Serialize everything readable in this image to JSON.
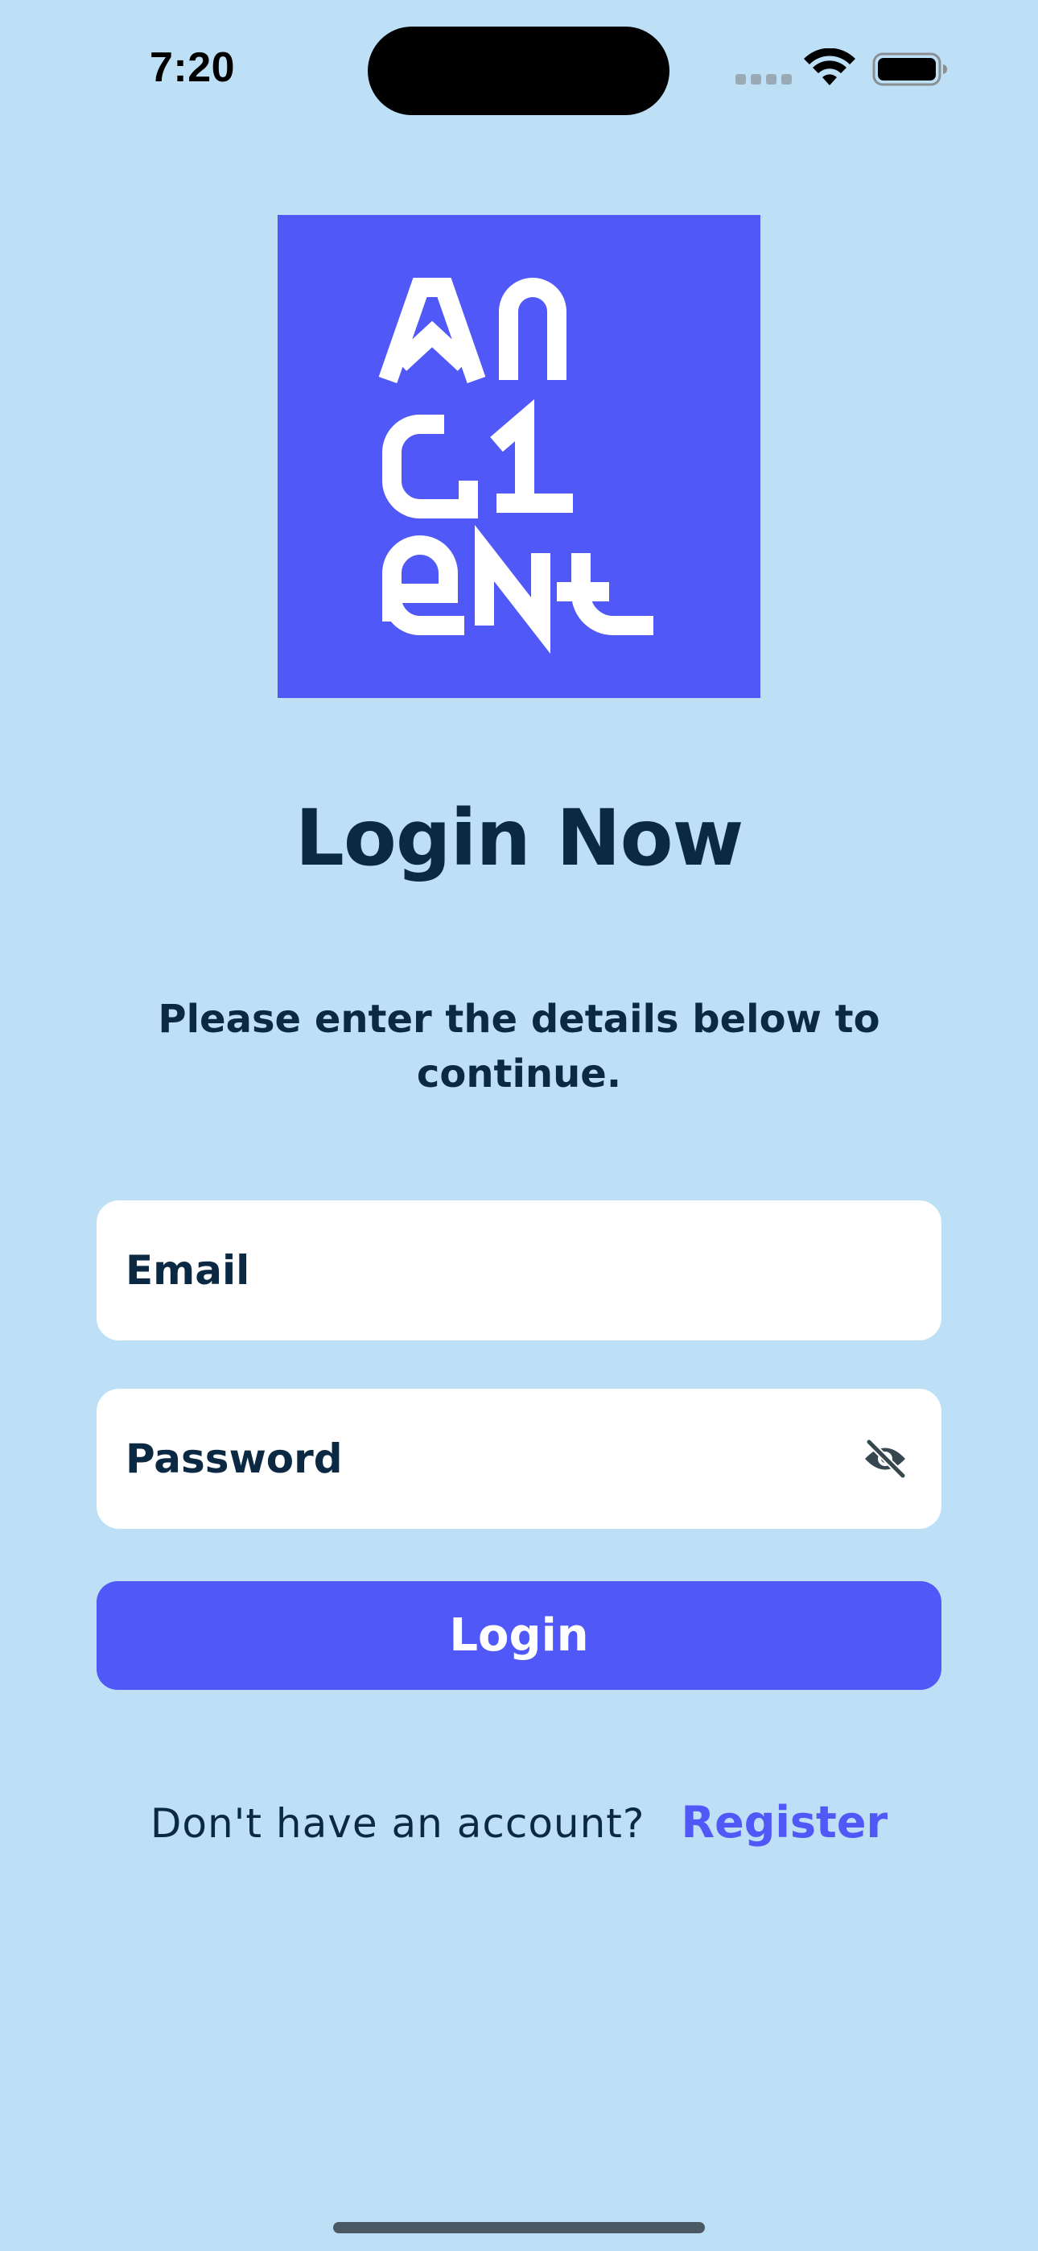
{
  "status_bar": {
    "time": "7:20"
  },
  "logo": {
    "brand_text": "ANCIENT",
    "background_color": "#5058f8"
  },
  "login": {
    "title": "Login Now",
    "subtitle": "Please enter the details below to continue.",
    "email": {
      "placeholder": "Email",
      "value": ""
    },
    "password": {
      "placeholder": "Password",
      "value": "",
      "toggle_icon": "eye-off-icon"
    },
    "submit_label": "Login"
  },
  "register": {
    "prompt": "Don't have an account?",
    "link_label": "Register"
  },
  "colors": {
    "background": "#bee0f6",
    "accent": "#5058f8",
    "text": "#0b2942"
  }
}
